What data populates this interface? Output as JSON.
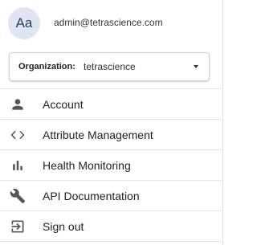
{
  "user": {
    "initials": "Aa",
    "email": "admin@tetrascience.com"
  },
  "organization": {
    "label": "Organization:",
    "value": "tetrascience"
  },
  "menu": {
    "items": [
      {
        "label": "Account",
        "icon": "person-icon"
      },
      {
        "label": "Attribute Management",
        "icon": "code-brackets-icon"
      },
      {
        "label": "Health Monitoring",
        "icon": "bar-chart-icon"
      },
      {
        "label": "API Documentation",
        "icon": "wrench-icon"
      },
      {
        "label": "Sign out",
        "icon": "sign-out-icon"
      }
    ]
  },
  "colors": {
    "avatar_background": "#dde6f2",
    "icon": "#555555",
    "divider": "#e6e6e6"
  }
}
